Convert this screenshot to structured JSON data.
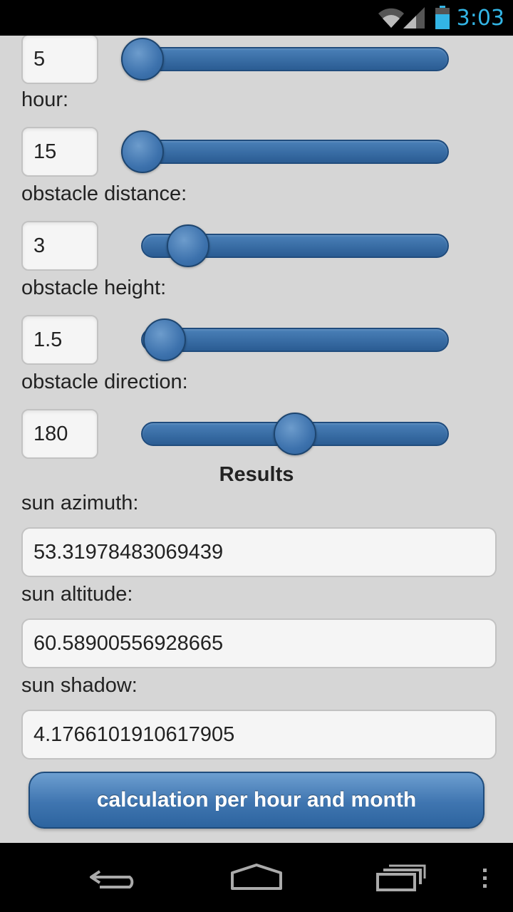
{
  "status_bar": {
    "time": "3:03"
  },
  "inputs": [
    {
      "label": "",
      "value": "5",
      "slider_fraction": 0.0
    },
    {
      "label": "hour:",
      "value": "15",
      "slider_fraction": 0.0
    },
    {
      "label": "obstacle distance:",
      "value": "3",
      "slider_fraction": 0.15
    },
    {
      "label": "obstacle height:",
      "value": "1.5",
      "slider_fraction": 0.07
    },
    {
      "label": "obstacle direction:",
      "value": "180",
      "slider_fraction": 0.5
    }
  ],
  "results": {
    "title": "Results",
    "items": [
      {
        "label": "sun azimuth:",
        "value": "53.31978483069439"
      },
      {
        "label": "sun altitude:",
        "value": "60.58900556928665"
      },
      {
        "label": "sun shadow:",
        "value": "4.176610191061790​5"
      }
    ]
  },
  "actions": {
    "calc_button": "calculation per hour and month"
  },
  "colors": {
    "accent": "#33b5e5",
    "slider": "#2f6399",
    "background": "#d6d6d6"
  }
}
